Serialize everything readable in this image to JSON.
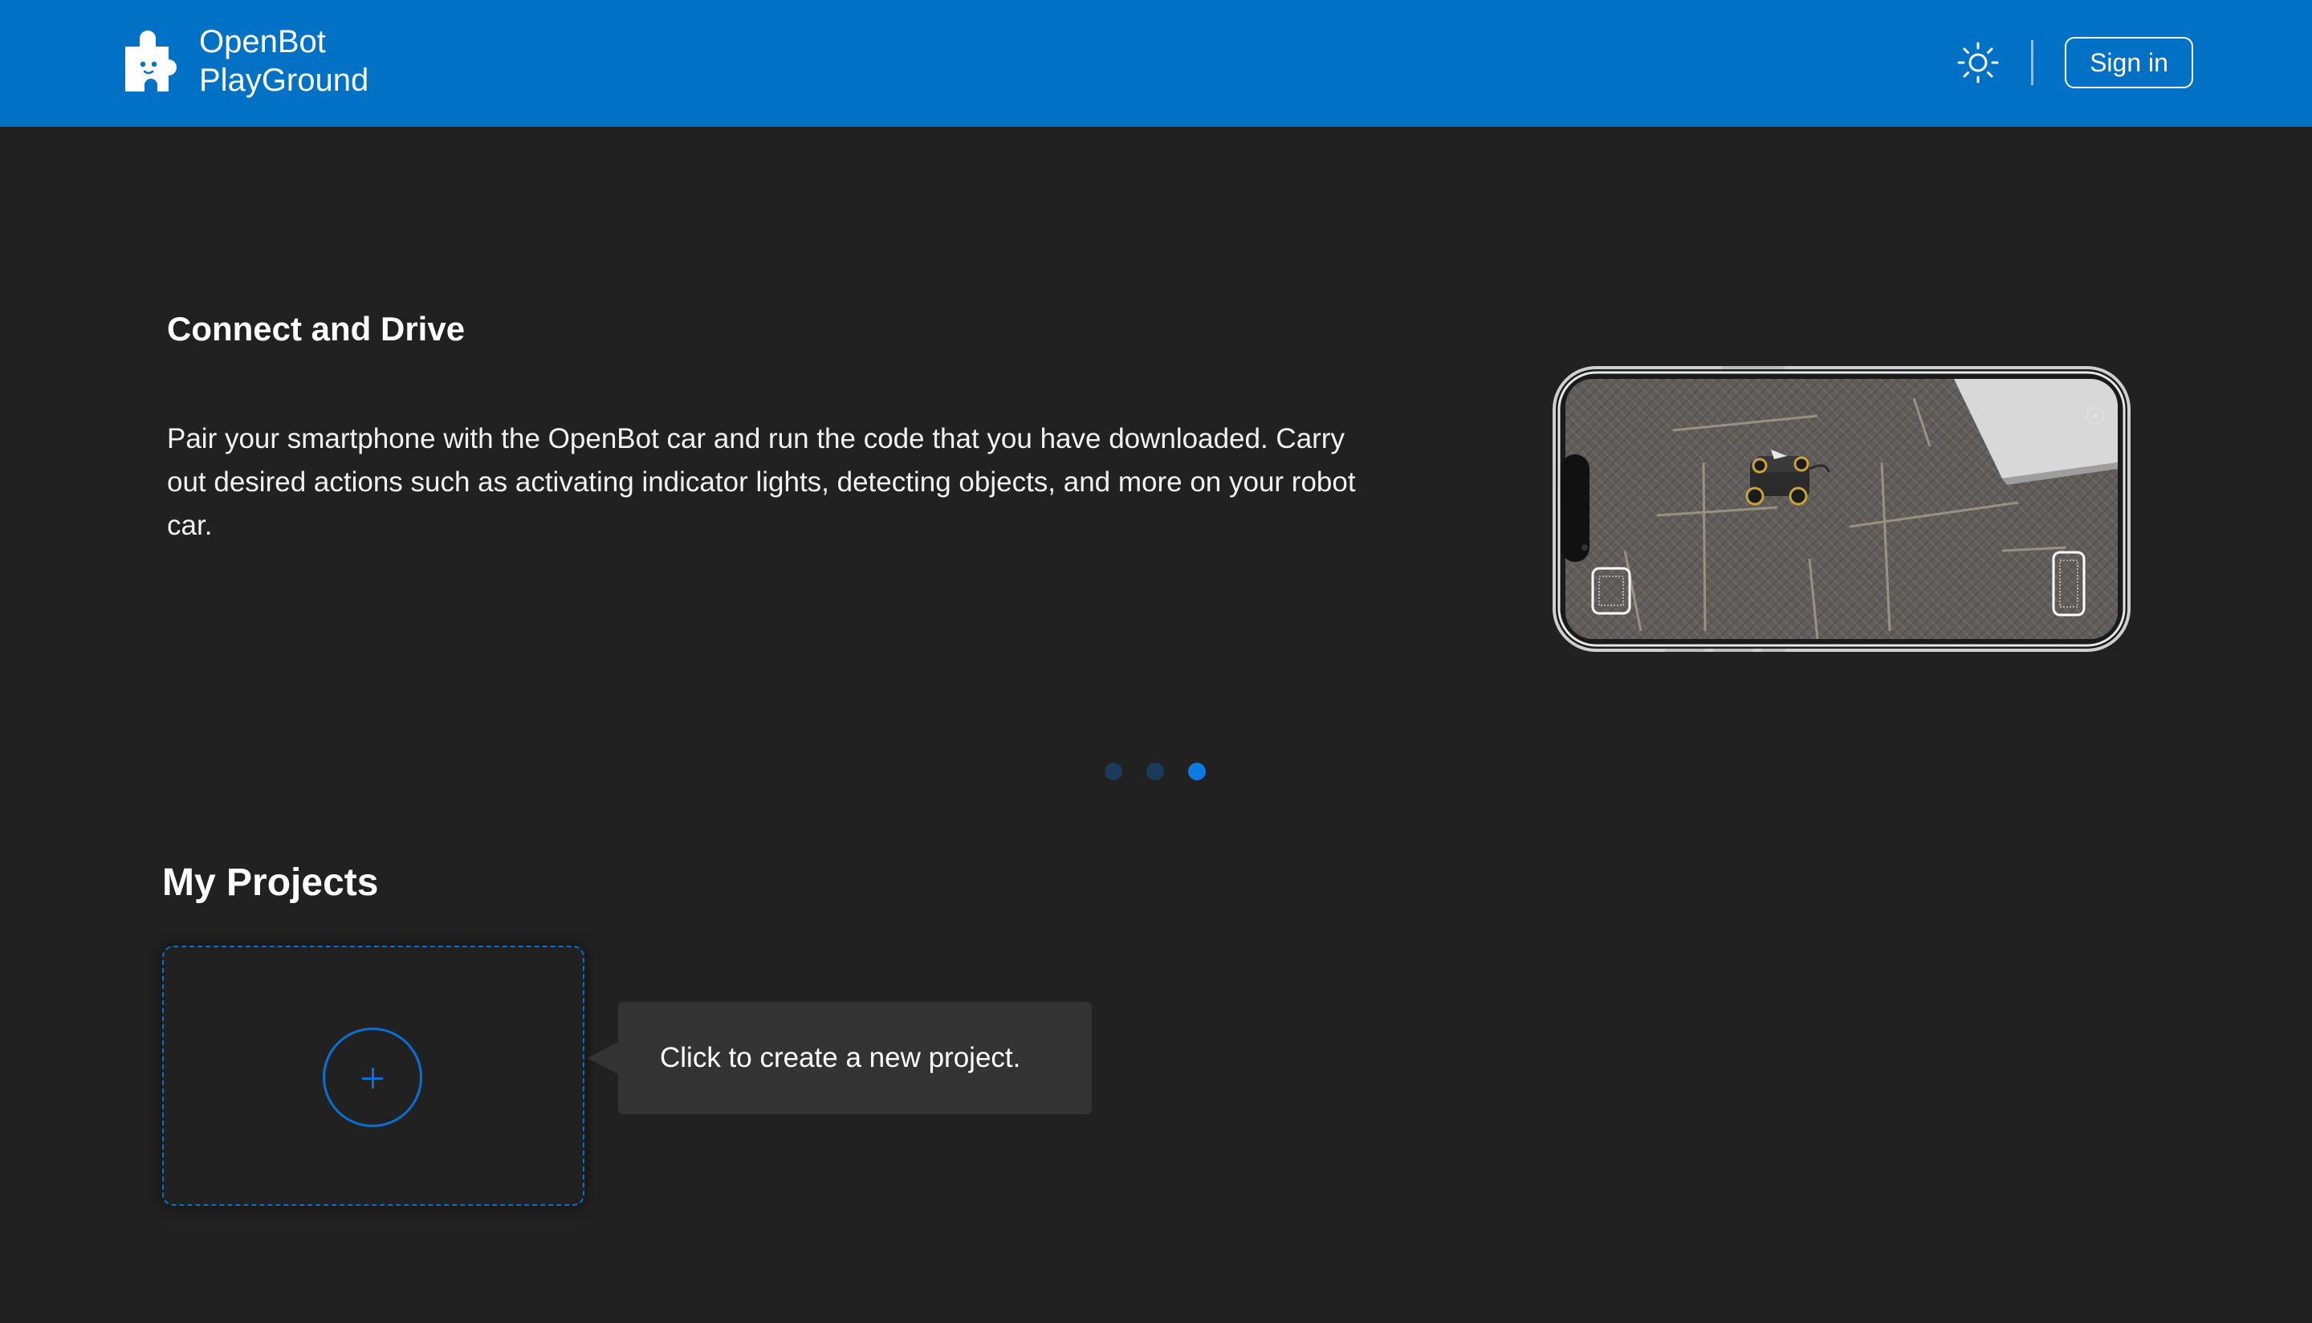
{
  "header": {
    "brand_line1": "OpenBot",
    "brand_line2": "PlayGround",
    "theme_icon": "sun-icon",
    "signin_label": "Sign in",
    "bg_color": "#0071c5"
  },
  "carousel": {
    "title": "Connect and Drive",
    "description": "Pair your smartphone with the OpenBot car and run the code that you have downloaded. Carry out desired actions such as activating indicator lights, detecting objects, and more on your robot car.",
    "image_icon": "phone-robot-car-illustration",
    "slide_count": 3,
    "active_slide": 3,
    "active_dot_color": "#0a7be0",
    "inactive_dot_color": "#1c3a5a"
  },
  "projects": {
    "title": "My Projects",
    "add_icon": "plus-icon",
    "tooltip": "Click to create a new project.",
    "accent_color": "#0a6fd0"
  }
}
